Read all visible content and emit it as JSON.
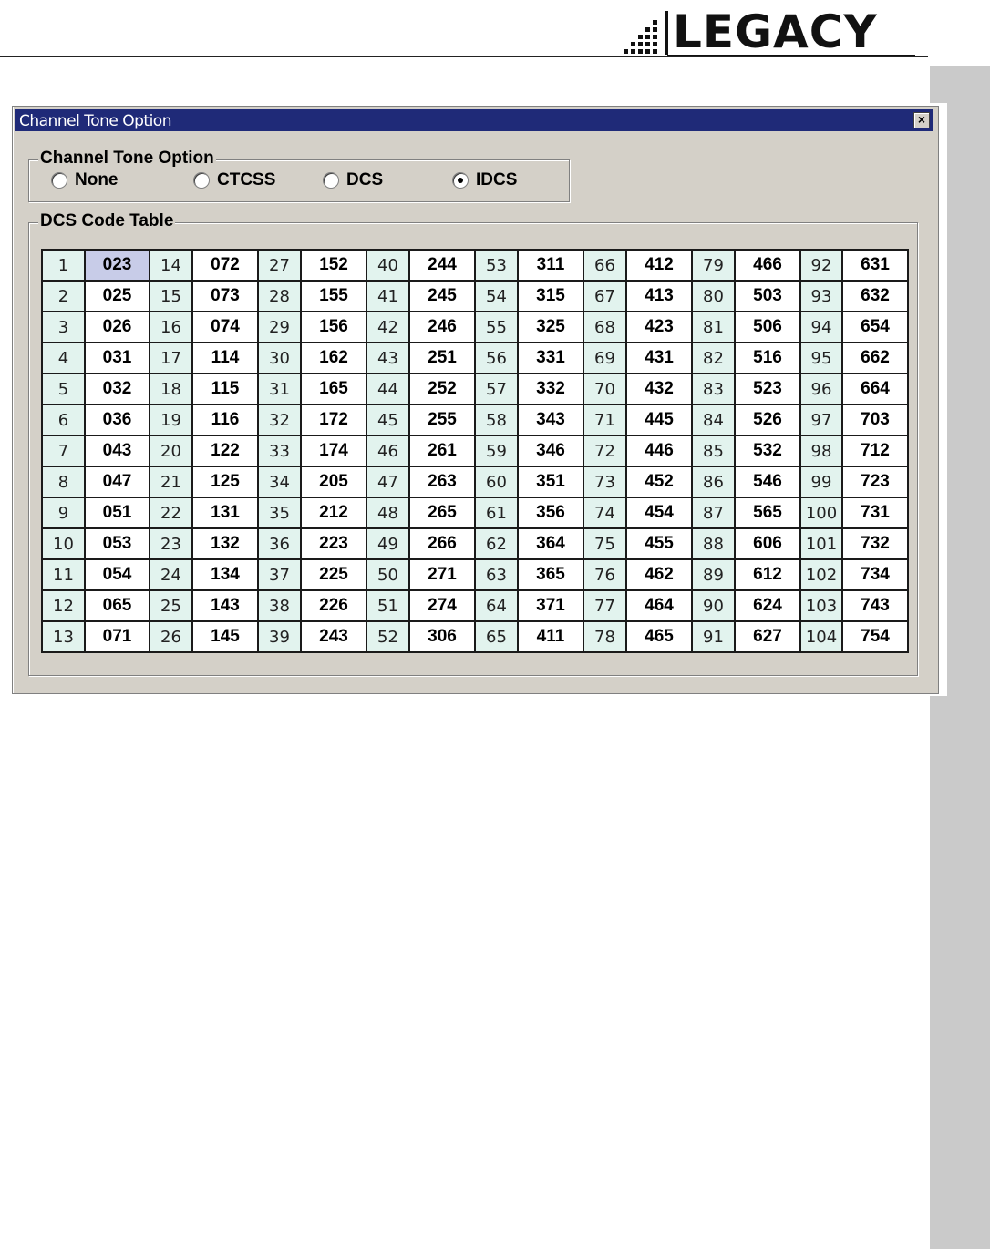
{
  "header": {
    "logo_text": "LEGACY"
  },
  "dialog": {
    "title": "Channel Tone Option",
    "close_label": "×",
    "tone_group": {
      "legend": "Channel Tone Option",
      "options": [
        {
          "label": "None",
          "selected": false
        },
        {
          "label": "CTCSS",
          "selected": false
        },
        {
          "label": "DCS",
          "selected": false
        },
        {
          "label": "IDCS",
          "selected": true
        }
      ]
    },
    "dcs_group": {
      "legend": "DCS Code Table",
      "selected_cell": {
        "row": 0,
        "col": 0
      },
      "rows": [
        [
          [
            "1",
            "023"
          ],
          [
            "14",
            "072"
          ],
          [
            "27",
            "152"
          ],
          [
            "40",
            "244"
          ],
          [
            "53",
            "311"
          ],
          [
            "66",
            "412"
          ],
          [
            "79",
            "466"
          ],
          [
            "92",
            "631"
          ]
        ],
        [
          [
            "2",
            "025"
          ],
          [
            "15",
            "073"
          ],
          [
            "28",
            "155"
          ],
          [
            "41",
            "245"
          ],
          [
            "54",
            "315"
          ],
          [
            "67",
            "413"
          ],
          [
            "80",
            "503"
          ],
          [
            "93",
            "632"
          ]
        ],
        [
          [
            "3",
            "026"
          ],
          [
            "16",
            "074"
          ],
          [
            "29",
            "156"
          ],
          [
            "42",
            "246"
          ],
          [
            "55",
            "325"
          ],
          [
            "68",
            "423"
          ],
          [
            "81",
            "506"
          ],
          [
            "94",
            "654"
          ]
        ],
        [
          [
            "4",
            "031"
          ],
          [
            "17",
            "114"
          ],
          [
            "30",
            "162"
          ],
          [
            "43",
            "251"
          ],
          [
            "56",
            "331"
          ],
          [
            "69",
            "431"
          ],
          [
            "82",
            "516"
          ],
          [
            "95",
            "662"
          ]
        ],
        [
          [
            "5",
            "032"
          ],
          [
            "18",
            "115"
          ],
          [
            "31",
            "165"
          ],
          [
            "44",
            "252"
          ],
          [
            "57",
            "332"
          ],
          [
            "70",
            "432"
          ],
          [
            "83",
            "523"
          ],
          [
            "96",
            "664"
          ]
        ],
        [
          [
            "6",
            "036"
          ],
          [
            "19",
            "116"
          ],
          [
            "32",
            "172"
          ],
          [
            "45",
            "255"
          ],
          [
            "58",
            "343"
          ],
          [
            "71",
            "445"
          ],
          [
            "84",
            "526"
          ],
          [
            "97",
            "703"
          ]
        ],
        [
          [
            "7",
            "043"
          ],
          [
            "20",
            "122"
          ],
          [
            "33",
            "174"
          ],
          [
            "46",
            "261"
          ],
          [
            "59",
            "346"
          ],
          [
            "72",
            "446"
          ],
          [
            "85",
            "532"
          ],
          [
            "98",
            "712"
          ]
        ],
        [
          [
            "8",
            "047"
          ],
          [
            "21",
            "125"
          ],
          [
            "34",
            "205"
          ],
          [
            "47",
            "263"
          ],
          [
            "60",
            "351"
          ],
          [
            "73",
            "452"
          ],
          [
            "86",
            "546"
          ],
          [
            "99",
            "723"
          ]
        ],
        [
          [
            "9",
            "051"
          ],
          [
            "22",
            "131"
          ],
          [
            "35",
            "212"
          ],
          [
            "48",
            "265"
          ],
          [
            "61",
            "356"
          ],
          [
            "74",
            "454"
          ],
          [
            "87",
            "565"
          ],
          [
            "100",
            "731"
          ]
        ],
        [
          [
            "10",
            "053"
          ],
          [
            "23",
            "132"
          ],
          [
            "36",
            "223"
          ],
          [
            "49",
            "266"
          ],
          [
            "62",
            "364"
          ],
          [
            "75",
            "455"
          ],
          [
            "88",
            "606"
          ],
          [
            "101",
            "732"
          ]
        ],
        [
          [
            "11",
            "054"
          ],
          [
            "24",
            "134"
          ],
          [
            "37",
            "225"
          ],
          [
            "50",
            "271"
          ],
          [
            "63",
            "365"
          ],
          [
            "76",
            "462"
          ],
          [
            "89",
            "612"
          ],
          [
            "102",
            "734"
          ]
        ],
        [
          [
            "12",
            "065"
          ],
          [
            "25",
            "143"
          ],
          [
            "38",
            "226"
          ],
          [
            "51",
            "274"
          ],
          [
            "64",
            "371"
          ],
          [
            "77",
            "464"
          ],
          [
            "90",
            "624"
          ],
          [
            "103",
            "743"
          ]
        ],
        [
          [
            "13",
            "071"
          ],
          [
            "26",
            "145"
          ],
          [
            "39",
            "243"
          ],
          [
            "52",
            "306"
          ],
          [
            "65",
            "411"
          ],
          [
            "78",
            "465"
          ],
          [
            "91",
            "627"
          ],
          [
            "104",
            "754"
          ]
        ]
      ]
    }
  },
  "colors": {
    "titlebar": "#1f2a78",
    "index_cell": "#e2f3ee",
    "selected_cell": "#c8cce8",
    "dialog_face": "#d4d0c8",
    "side_band": "#cacaca"
  }
}
